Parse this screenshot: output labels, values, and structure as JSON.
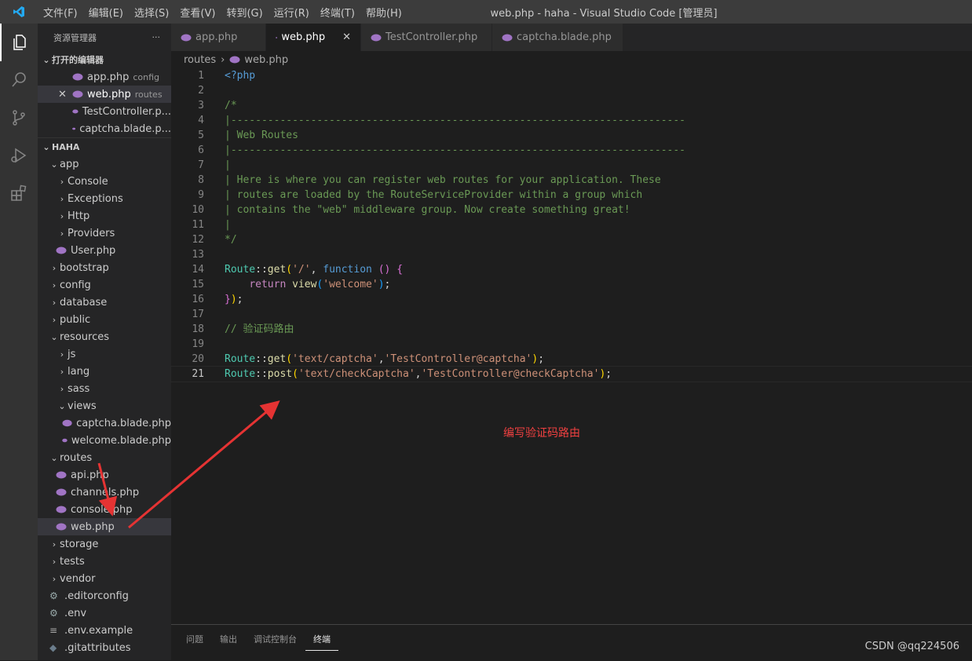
{
  "titlebar": {
    "menu": [
      "文件(F)",
      "编辑(E)",
      "选择(S)",
      "查看(V)",
      "转到(G)",
      "运行(R)",
      "终端(T)",
      "帮助(H)"
    ],
    "window_title": "web.php - haha - Visual Studio Code [管理员]"
  },
  "sidebar": {
    "title": "资源管理器",
    "more": "···",
    "open_editors_label": "打开的编辑器",
    "open_editors": [
      {
        "name": "app.php",
        "desc": "config"
      },
      {
        "name": "web.php",
        "desc": "routes"
      },
      {
        "name": "TestController.p..."
      },
      {
        "name": "captcha.blade.p..."
      }
    ],
    "project_label": "HAHA",
    "tree": {
      "app": "app",
      "console": "Console",
      "exceptions": "Exceptions",
      "http": "Http",
      "providers": "Providers",
      "user": "User.php",
      "bootstrap": "bootstrap",
      "config": "config",
      "database": "database",
      "public": "public",
      "resources": "resources",
      "js": "js",
      "lang": "lang",
      "sass": "sass",
      "views": "views",
      "captcha_blade": "captcha.blade.php",
      "welcome_blade": "welcome.blade.php",
      "routes": "routes",
      "api": "api.php",
      "channels": "channels.php",
      "console_php": "console.php",
      "web": "web.php",
      "storage": "storage",
      "tests": "tests",
      "vendor": "vendor",
      "editorconfig": ".editorconfig",
      "env": ".env",
      "env_example": ".env.example",
      "gitattributes": ".gitattributes"
    }
  },
  "tabs": [
    {
      "label": "app.php"
    },
    {
      "label": "web.php",
      "close": "✕"
    },
    {
      "label": "TestController.php"
    },
    {
      "label": "captcha.blade.php"
    }
  ],
  "breadcrumb": {
    "folder": "routes",
    "sep": "›",
    "file": "web.php"
  },
  "code": {
    "l1": "<?php",
    "l3": "/*",
    "l4": "|--------------------------------------------------------------------------",
    "l5": "| Web Routes",
    "l6": "|--------------------------------------------------------------------------",
    "l7": "|",
    "l8": "| Here is where you can register web routes for your application. These",
    "l9": "| routes are loaded by the RouteServiceProvider within a group which",
    "l10": "| contains the \"web\" middleware group. Now create something great!",
    "l11": "|",
    "l12": "*/",
    "route": "Route",
    "dc": "::",
    "get": "get",
    "post": "post",
    "s_root": "'/'",
    "comma_sp": ", ",
    "function": "function",
    "sp": " ",
    "parens": "()",
    "lbrace": "{",
    "return": "return",
    "view": "view",
    "s_welcome": "'welcome'",
    "semi": ";",
    "rbrace": "}",
    "lp": "(",
    "rp": ")",
    "comma": ",",
    "indent": "    ",
    "c_route": "// 验证码路由",
    "s_captcha": "'text/captcha'",
    "s_ctrl_captcha": "'TestController@captcha'",
    "s_check": "'text/checkCaptcha'",
    "s_ctrl_check": "'TestController@checkCaptcha'"
  },
  "line_numbers": [
    "1",
    "2",
    "3",
    "4",
    "5",
    "6",
    "7",
    "8",
    "9",
    "10",
    "11",
    "12",
    "13",
    "14",
    "15",
    "16",
    "17",
    "18",
    "19",
    "20",
    "21"
  ],
  "annotation": "编写验证码路由",
  "panel": {
    "tabs": [
      "问题",
      "输出",
      "调试控制台",
      "终端"
    ]
  },
  "watermark": "CSDN @qq224506",
  "colors": {
    "accent": "#007acc",
    "annotation": "#f04040"
  }
}
